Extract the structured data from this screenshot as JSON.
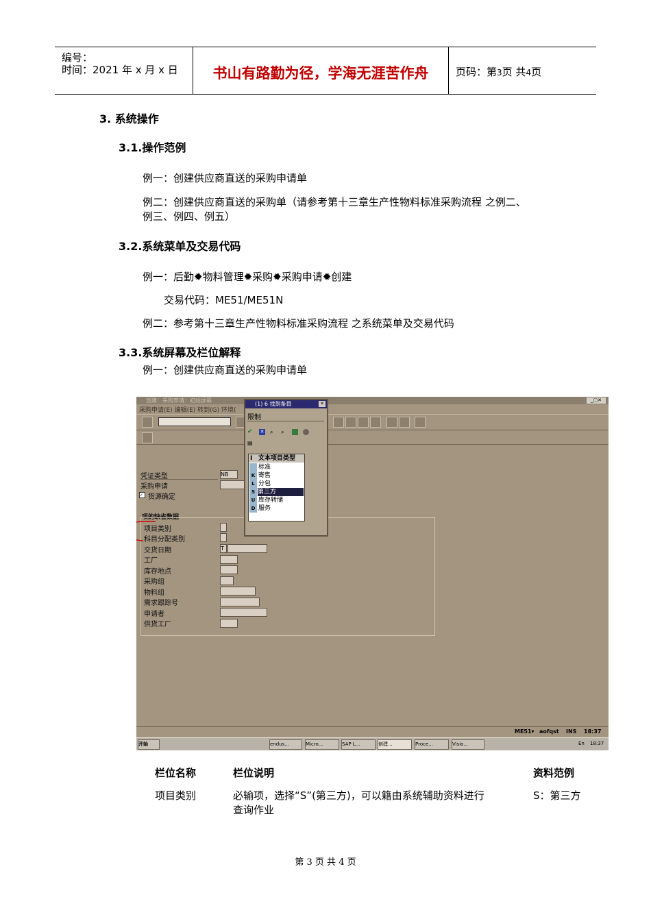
{
  "header": {
    "number_label": "编号：",
    "time_label": "时间：2021 年 x 月 x 日",
    "motto": "书山有路勤为径，学海无涯苦作舟",
    "page_prefix": "页码：第",
    "page_num": "3",
    "page_mid": "页  共",
    "page_total": "4",
    "page_suffix": "页"
  },
  "sections": {
    "s3": "3.  系统操作",
    "s31": "3.1.操作范例",
    "s31_ex1": "例一：创建供应商直送的采购申请单",
    "s31_ex2_line1": "例二：创建供应商直送的采购单（请参考第十三章生产性物料标准采购流程 之例二、",
    "s31_ex2_line2": "例三、例四、例五）",
    "s32": "3.2.系统菜单及交易代码",
    "s32_ex1": "例一：后勤✹物料管理✹采购✹采购申请✹创建",
    "s32_code": "交易代码：ME51/ME51N",
    "s32_ex2": "例二：参考第十三章生产性物料标准采购流程 之系统菜单及交易代码",
    "s33": "3.3.系统屏幕及栏位解释",
    "s33_ex1": "例一：创建供应商直送的采购申请单"
  },
  "sap": {
    "title": "创建：采购申请：初始屏幕",
    "menu": "采购申请(E)  编辑(E)  转到(G)  环境(",
    "fields": {
      "doc_type_label": "凭证类型",
      "doc_type_value": "NB",
      "pr_label": "采购申请",
      "source_label": "货源确定",
      "group_title": "项的缺省数据",
      "item_cat": "项目类别",
      "acct_cat": "科目分配类别",
      "deliv_date": "交货日期",
      "deliv_date_value": "T",
      "plant": "工厂",
      "sloc": "库存地点",
      "pgroup": "采购组",
      "mgroup": "物料组",
      "tracking": "需求跟踪号",
      "requester": "申请者",
      "supply_plant": "供货工厂"
    },
    "popup": {
      "title": "(1)   6 找到条目",
      "tab": "限制",
      "col_key": "I",
      "col_text": "文本项目类型",
      "rows": [
        {
          "key": "",
          "text": "标准"
        },
        {
          "key": "K",
          "text": "寄售"
        },
        {
          "key": "L",
          "text": "分包"
        },
        {
          "key": "S",
          "text": "第三方"
        },
        {
          "key": "U",
          "text": "库存转储"
        },
        {
          "key": "D",
          "text": "服务"
        }
      ]
    },
    "status": {
      "tcode": "ME51▾",
      "server": "aofqst",
      "mode": "INS",
      "time": "18:37"
    },
    "taskbar": {
      "start": "开始",
      "tasks": [
        "endus...",
        "Micro...",
        "SAP L...",
        "创建...",
        "Proce...",
        "Visio..."
      ],
      "clock": "18:37",
      "lang": "En"
    }
  },
  "table": {
    "headers": [
      "栏位名称",
      "栏位说明",
      "资料范例"
    ],
    "rows": [
      {
        "name": "项目类别",
        "desc_line1": "必输项，选择“S”(第三方)，可以籍由系统辅助资料进行",
        "desc_line2": "查询作业",
        "example": "S：第三方"
      }
    ]
  },
  "footer": "第 3 页 共 4 页"
}
